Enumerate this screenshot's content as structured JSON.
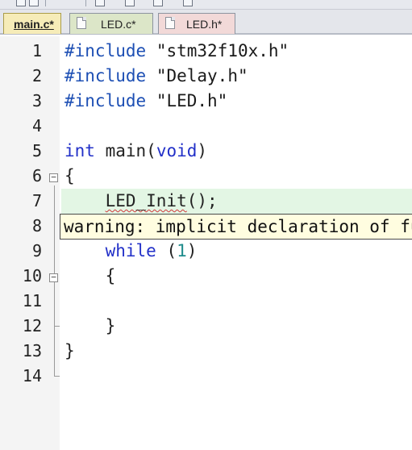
{
  "tabs": [
    {
      "label": "main.c*",
      "active": true
    },
    {
      "label": "LED.c*",
      "active": false
    },
    {
      "label": "LED.h*",
      "active": false
    }
  ],
  "editor": {
    "line_numbers": [
      "1",
      "2",
      "3",
      "4",
      "5",
      "6",
      "7",
      "8",
      "9",
      "10",
      "11",
      "12",
      "13",
      "14"
    ],
    "lines": {
      "l1_directive": "#include",
      "l1_arg": "\"stm32f10x.h\"",
      "l2_directive": "#include",
      "l2_arg": "\"Delay.h\"",
      "l3_directive": "#include",
      "l3_arg": "\"LED.h\"",
      "l5_type": "int",
      "l5_name": "main(",
      "l5_param": "void",
      "l5_close": ")",
      "l6": "{",
      "l7_call": "LED_Init",
      "l7_rest": "();",
      "l9_kw": "while",
      "l9_open": "(",
      "l9_num": "1",
      "l9_close": ")",
      "l10": "{",
      "l12": "}",
      "l13": "}"
    },
    "current_line": 7
  },
  "tooltip": {
    "text": "warning: implicit declaration of function 'LED_Init'"
  }
}
